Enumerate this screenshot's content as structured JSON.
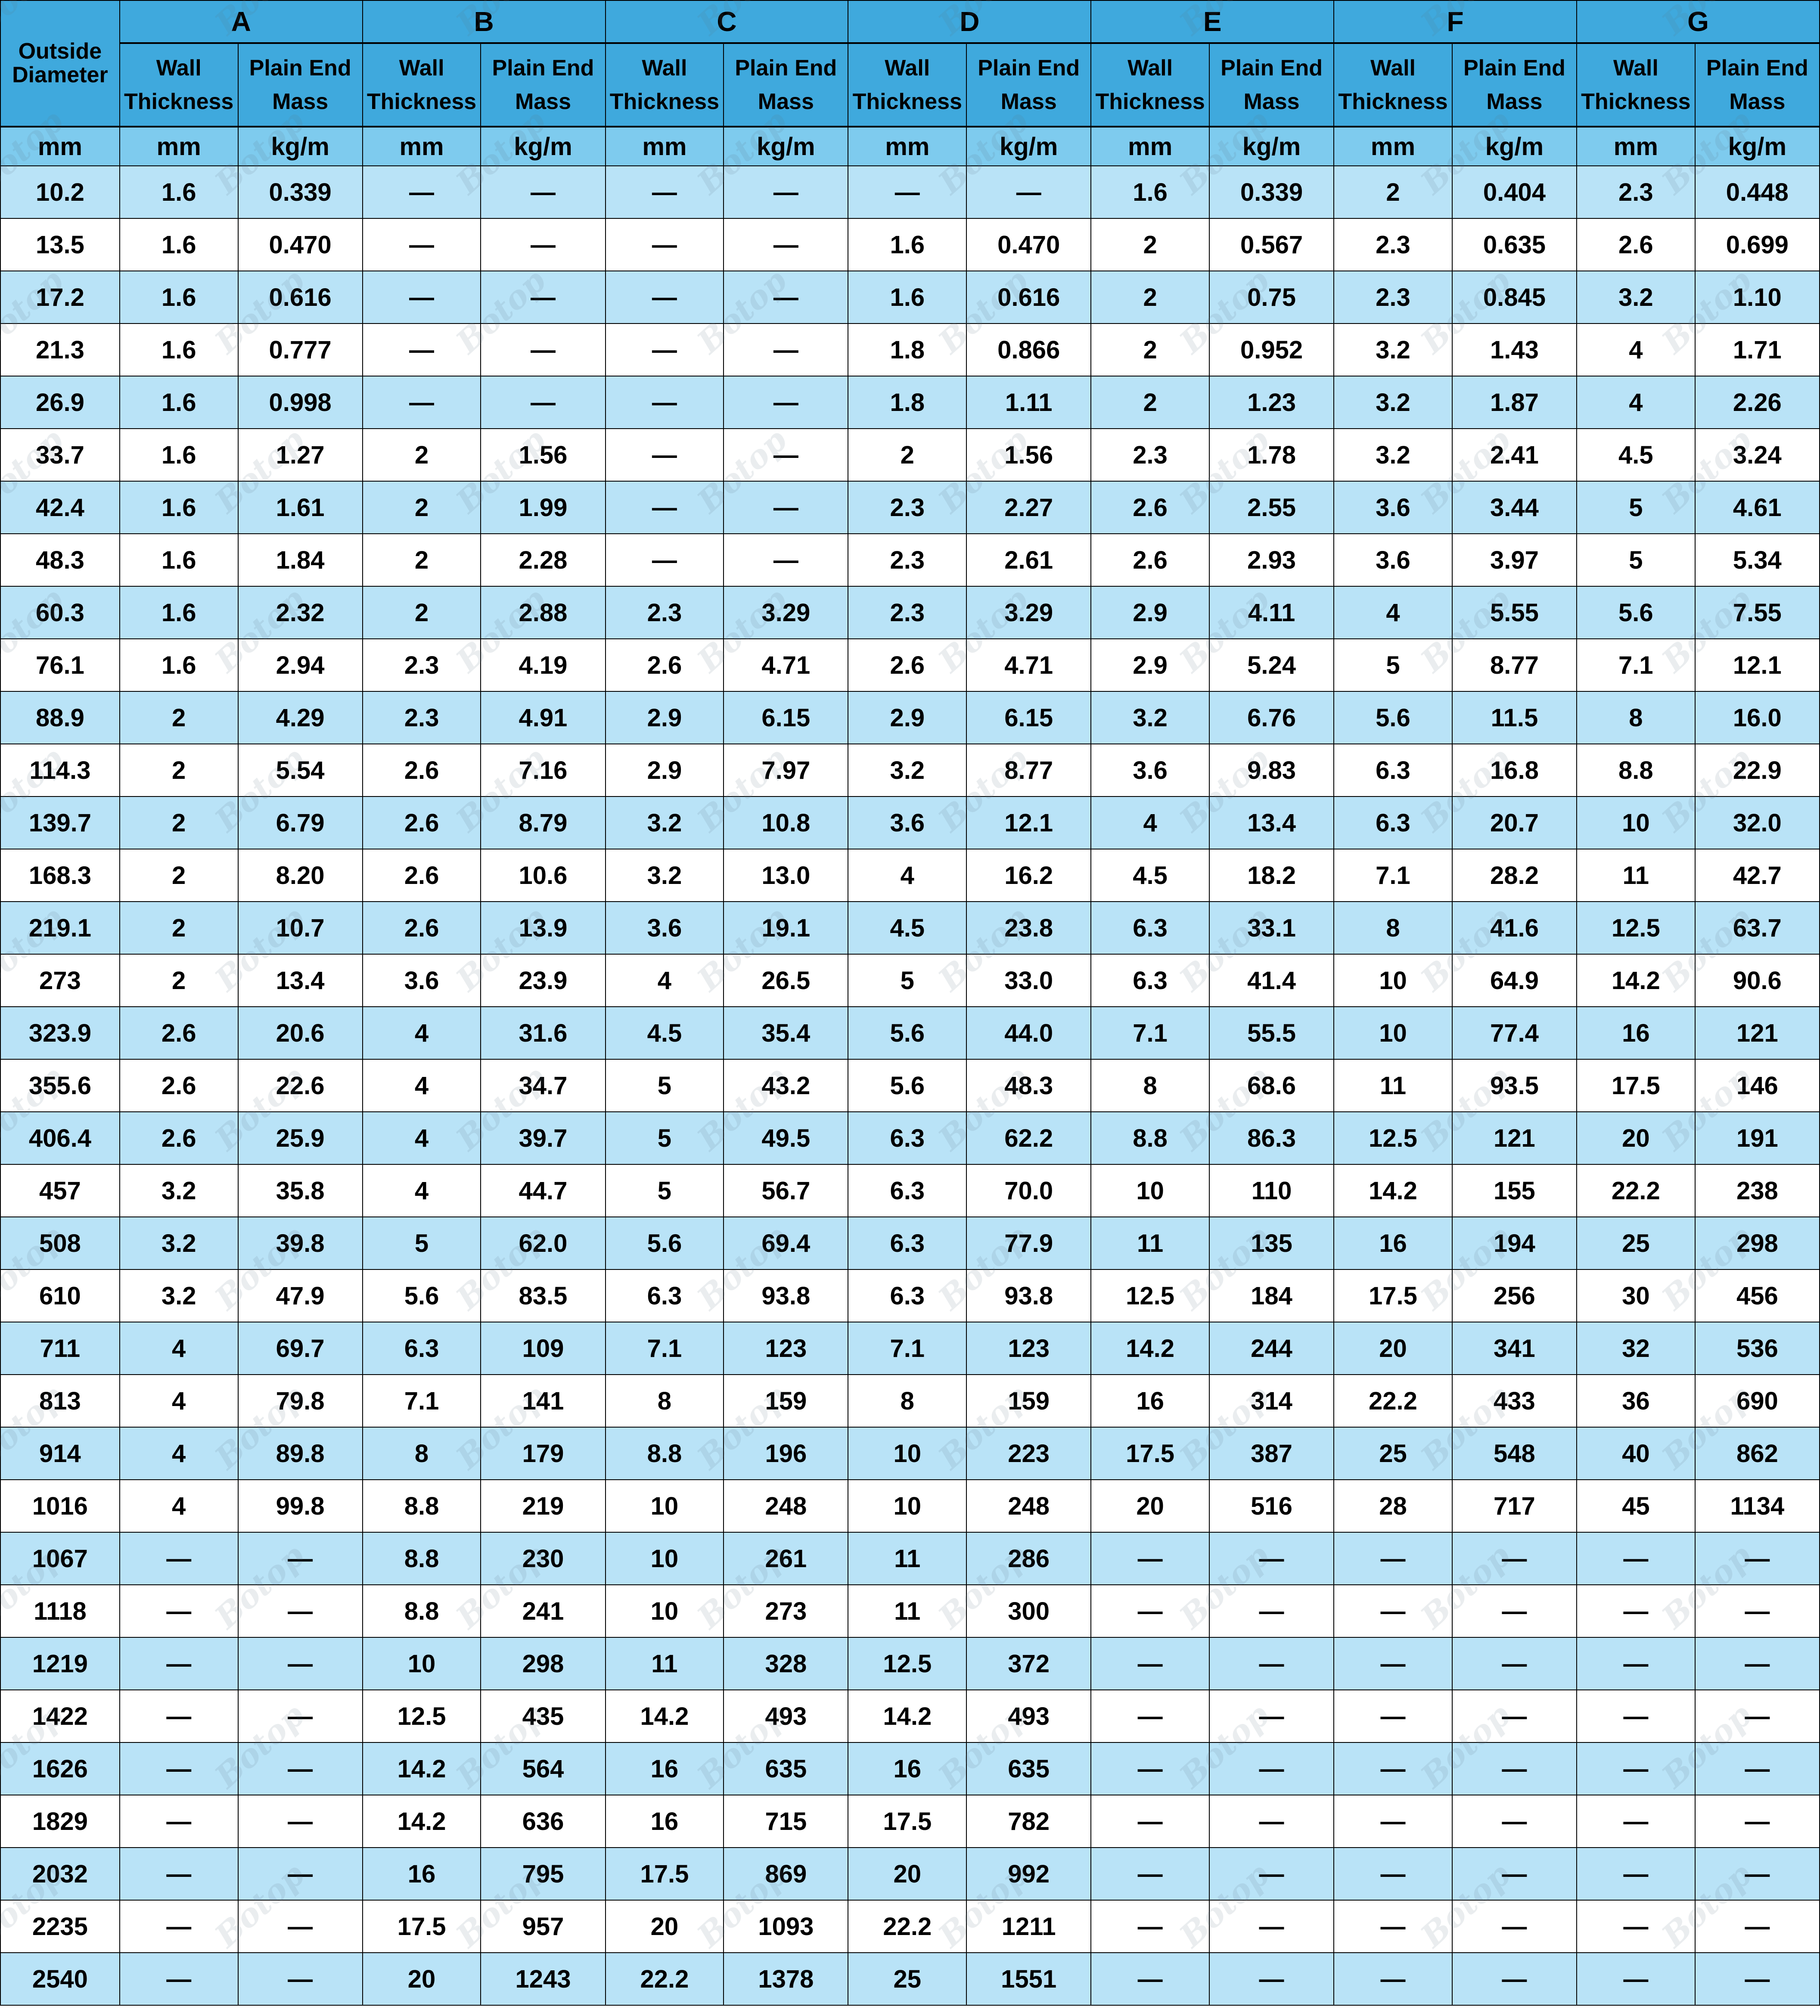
{
  "table": {
    "row_header_label": "Outside Diameter",
    "groups": [
      "A",
      "B",
      "C",
      "D",
      "E",
      "F",
      "G"
    ],
    "sub_headers": [
      "Wall Thickness",
      "Plain End Mass"
    ],
    "units": {
      "outside_diameter": "mm",
      "wall_thickness": "mm",
      "plain_end_mass": "kg/m"
    },
    "empty_marker": "—",
    "colors": {
      "header_blue": "#3fa9dd",
      "unit_blue": "#7ecbee",
      "row_shade_blue": "#b9e3f7",
      "row_plain": "#ffffff",
      "border": "#000000",
      "watermark": "rgba(90,115,130,0.13)"
    },
    "watermark_text": "Botop"
  },
  "chart_data": {
    "type": "table",
    "title": "",
    "columns": [
      "Outside Diameter",
      "A Wall Thickness",
      "A Plain End Mass",
      "B Wall Thickness",
      "B Plain End Mass",
      "C Wall Thickness",
      "C Plain End Mass",
      "D Wall Thickness",
      "D Plain End Mass",
      "E Wall Thickness",
      "E Plain End Mass",
      "F Wall Thickness",
      "F Plain End Mass",
      "G Wall Thickness",
      "G Plain End Mass"
    ],
    "units_row": [
      "mm",
      "mm",
      "kg/m",
      "mm",
      "kg/m",
      "mm",
      "kg/m",
      "mm",
      "kg/m",
      "mm",
      "kg/m",
      "mm",
      "kg/m",
      "mm",
      "kg/m"
    ],
    "rows": [
      [
        "10.2",
        "1.6",
        "0.339",
        "—",
        "—",
        "—",
        "—",
        "—",
        "—",
        "1.6",
        "0.339",
        "2",
        "0.404",
        "2.3",
        "0.448"
      ],
      [
        "13.5",
        "1.6",
        "0.470",
        "—",
        "—",
        "—",
        "—",
        "1.6",
        "0.470",
        "2",
        "0.567",
        "2.3",
        "0.635",
        "2.6",
        "0.699"
      ],
      [
        "17.2",
        "1.6",
        "0.616",
        "—",
        "—",
        "—",
        "—",
        "1.6",
        "0.616",
        "2",
        "0.75",
        "2.3",
        "0.845",
        "3.2",
        "1.10"
      ],
      [
        "21.3",
        "1.6",
        "0.777",
        "—",
        "—",
        "—",
        "—",
        "1.8",
        "0.866",
        "2",
        "0.952",
        "3.2",
        "1.43",
        "4",
        "1.71"
      ],
      [
        "26.9",
        "1.6",
        "0.998",
        "—",
        "—",
        "—",
        "—",
        "1.8",
        "1.11",
        "2",
        "1.23",
        "3.2",
        "1.87",
        "4",
        "2.26"
      ],
      [
        "33.7",
        "1.6",
        "1.27",
        "2",
        "1.56",
        "—",
        "—",
        "2",
        "1.56",
        "2.3",
        "1.78",
        "3.2",
        "2.41",
        "4.5",
        "3.24"
      ],
      [
        "42.4",
        "1.6",
        "1.61",
        "2",
        "1.99",
        "—",
        "—",
        "2.3",
        "2.27",
        "2.6",
        "2.55",
        "3.6",
        "3.44",
        "5",
        "4.61"
      ],
      [
        "48.3",
        "1.6",
        "1.84",
        "2",
        "2.28",
        "—",
        "—",
        "2.3",
        "2.61",
        "2.6",
        "2.93",
        "3.6",
        "3.97",
        "5",
        "5.34"
      ],
      [
        "60.3",
        "1.6",
        "2.32",
        "2",
        "2.88",
        "2.3",
        "3.29",
        "2.3",
        "3.29",
        "2.9",
        "4.11",
        "4",
        "5.55",
        "5.6",
        "7.55"
      ],
      [
        "76.1",
        "1.6",
        "2.94",
        "2.3",
        "4.19",
        "2.6",
        "4.71",
        "2.6",
        "4.71",
        "2.9",
        "5.24",
        "5",
        "8.77",
        "7.1",
        "12.1"
      ],
      [
        "88.9",
        "2",
        "4.29",
        "2.3",
        "4.91",
        "2.9",
        "6.15",
        "2.9",
        "6.15",
        "3.2",
        "6.76",
        "5.6",
        "11.5",
        "8",
        "16.0"
      ],
      [
        "114.3",
        "2",
        "5.54",
        "2.6",
        "7.16",
        "2.9",
        "7.97",
        "3.2",
        "8.77",
        "3.6",
        "9.83",
        "6.3",
        "16.8",
        "8.8",
        "22.9"
      ],
      [
        "139.7",
        "2",
        "6.79",
        "2.6",
        "8.79",
        "3.2",
        "10.8",
        "3.6",
        "12.1",
        "4",
        "13.4",
        "6.3",
        "20.7",
        "10",
        "32.0"
      ],
      [
        "168.3",
        "2",
        "8.20",
        "2.6",
        "10.6",
        "3.2",
        "13.0",
        "4",
        "16.2",
        "4.5",
        "18.2",
        "7.1",
        "28.2",
        "11",
        "42.7"
      ],
      [
        "219.1",
        "2",
        "10.7",
        "2.6",
        "13.9",
        "3.6",
        "19.1",
        "4.5",
        "23.8",
        "6.3",
        "33.1",
        "8",
        "41.6",
        "12.5",
        "63.7"
      ],
      [
        "273",
        "2",
        "13.4",
        "3.6",
        "23.9",
        "4",
        "26.5",
        "5",
        "33.0",
        "6.3",
        "41.4",
        "10",
        "64.9",
        "14.2",
        "90.6"
      ],
      [
        "323.9",
        "2.6",
        "20.6",
        "4",
        "31.6",
        "4.5",
        "35.4",
        "5.6",
        "44.0",
        "7.1",
        "55.5",
        "10",
        "77.4",
        "16",
        "121"
      ],
      [
        "355.6",
        "2.6",
        "22.6",
        "4",
        "34.7",
        "5",
        "43.2",
        "5.6",
        "48.3",
        "8",
        "68.6",
        "11",
        "93.5",
        "17.5",
        "146"
      ],
      [
        "406.4",
        "2.6",
        "25.9",
        "4",
        "39.7",
        "5",
        "49.5",
        "6.3",
        "62.2",
        "8.8",
        "86.3",
        "12.5",
        "121",
        "20",
        "191"
      ],
      [
        "457",
        "3.2",
        "35.8",
        "4",
        "44.7",
        "5",
        "56.7",
        "6.3",
        "70.0",
        "10",
        "110",
        "14.2",
        "155",
        "22.2",
        "238"
      ],
      [
        "508",
        "3.2",
        "39.8",
        "5",
        "62.0",
        "5.6",
        "69.4",
        "6.3",
        "77.9",
        "11",
        "135",
        "16",
        "194",
        "25",
        "298"
      ],
      [
        "610",
        "3.2",
        "47.9",
        "5.6",
        "83.5",
        "6.3",
        "93.8",
        "6.3",
        "93.8",
        "12.5",
        "184",
        "17.5",
        "256",
        "30",
        "456"
      ],
      [
        "711",
        "4",
        "69.7",
        "6.3",
        "109",
        "7.1",
        "123",
        "7.1",
        "123",
        "14.2",
        "244",
        "20",
        "341",
        "32",
        "536"
      ],
      [
        "813",
        "4",
        "79.8",
        "7.1",
        "141",
        "8",
        "159",
        "8",
        "159",
        "16",
        "314",
        "22.2",
        "433",
        "36",
        "690"
      ],
      [
        "914",
        "4",
        "89.8",
        "8",
        "179",
        "8.8",
        "196",
        "10",
        "223",
        "17.5",
        "387",
        "25",
        "548",
        "40",
        "862"
      ],
      [
        "1016",
        "4",
        "99.8",
        "8.8",
        "219",
        "10",
        "248",
        "10",
        "248",
        "20",
        "516",
        "28",
        "717",
        "45",
        "1134"
      ],
      [
        "1067",
        "—",
        "—",
        "8.8",
        "230",
        "10",
        "261",
        "11",
        "286",
        "—",
        "—",
        "—",
        "—",
        "—",
        "—"
      ],
      [
        "1118",
        "—",
        "—",
        "8.8",
        "241",
        "10",
        "273",
        "11",
        "300",
        "—",
        "—",
        "—",
        "—",
        "—",
        "—"
      ],
      [
        "1219",
        "—",
        "—",
        "10",
        "298",
        "11",
        "328",
        "12.5",
        "372",
        "—",
        "—",
        "—",
        "—",
        "—",
        "—"
      ],
      [
        "1422",
        "—",
        "—",
        "12.5",
        "435",
        "14.2",
        "493",
        "14.2",
        "493",
        "—",
        "—",
        "—",
        "—",
        "—",
        "—"
      ],
      [
        "1626",
        "—",
        "—",
        "14.2",
        "564",
        "16",
        "635",
        "16",
        "635",
        "—",
        "—",
        "—",
        "—",
        "—",
        "—"
      ],
      [
        "1829",
        "—",
        "—",
        "14.2",
        "636",
        "16",
        "715",
        "17.5",
        "782",
        "—",
        "—",
        "—",
        "—",
        "—",
        "—"
      ],
      [
        "2032",
        "—",
        "—",
        "16",
        "795",
        "17.5",
        "869",
        "20",
        "992",
        "—",
        "—",
        "—",
        "—",
        "—",
        "—"
      ],
      [
        "2235",
        "—",
        "—",
        "17.5",
        "957",
        "20",
        "1093",
        "22.2",
        "1211",
        "—",
        "—",
        "—",
        "—",
        "—",
        "—"
      ],
      [
        "2540",
        "—",
        "—",
        "20",
        "1243",
        "22.2",
        "1378",
        "25",
        "1551",
        "—",
        "—",
        "—",
        "—",
        "—",
        "—"
      ]
    ]
  }
}
